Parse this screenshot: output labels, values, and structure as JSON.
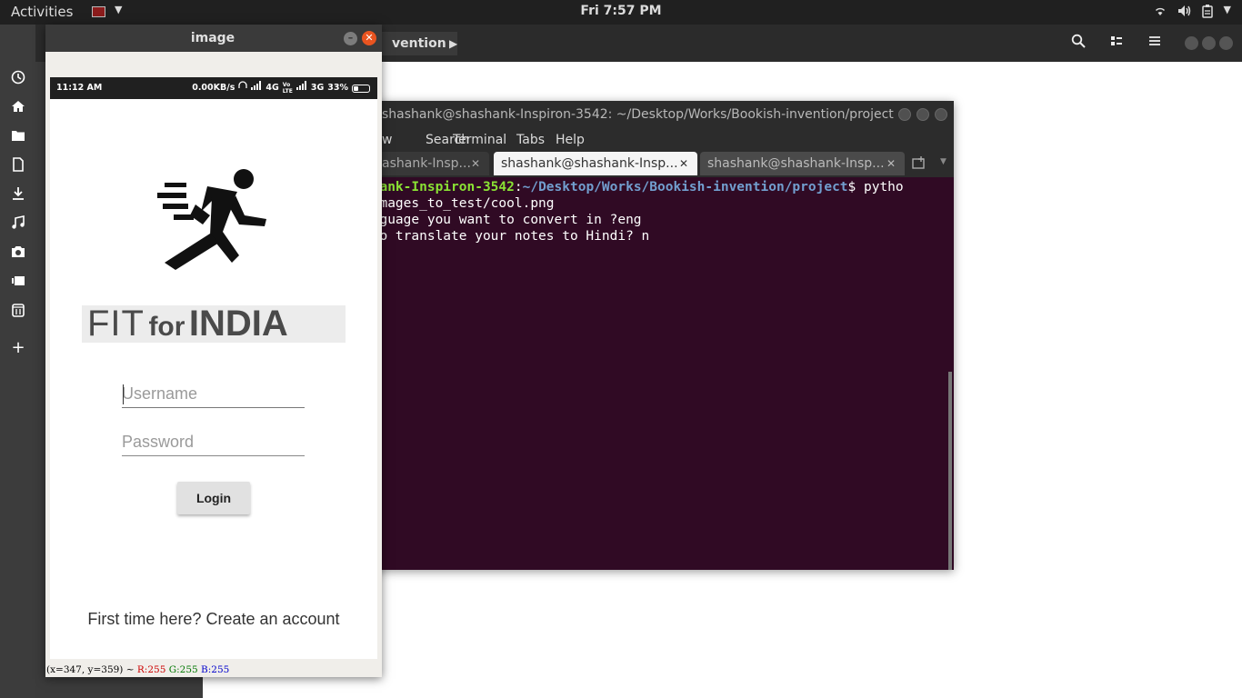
{
  "topbar": {
    "activities": "Activities",
    "clock": "Fri  7:57 PM",
    "tray_icons": [
      "wifi-icon",
      "volume-icon",
      "clipboard-icon",
      "menu-arrow-icon"
    ]
  },
  "dock": {
    "icons": [
      "recent-icon",
      "home-icon",
      "folder-icon",
      "document-icon",
      "download-icon",
      "music-icon",
      "camera-icon",
      "video-icon",
      "trash-icon",
      "add-location-icon"
    ]
  },
  "files": {
    "breadcrumb": "vention"
  },
  "terminal": {
    "title": "shashank@shashank-Inspiron-3542: ~/Desktop/Works/Bookish-invention/project",
    "menu": [
      "w",
      "Search",
      "Terminal",
      "Tabs",
      "Help"
    ],
    "tabs": [
      {
        "label": "ashank-Insp..."
      },
      {
        "label": "shashank@shashank-Insp..."
      },
      {
        "label": "shashank@shashank-Insp..."
      }
    ],
    "prompt_user": "shank-Inspiron-3542",
    "prompt_path": "~/Desktop/Works/Bookish-invention/project",
    "prompt_cmd": "$ pytho",
    "lines": [
      "/images_to_test/cool.png",
      "anguage you want to convert in ?eng",
      " to translate your notes to Hindi? n"
    ]
  },
  "viewer": {
    "title": "image",
    "status": {
      "coords": "(x=347, y=359) ~",
      "r": "R:255",
      "g": "G:255",
      "b": "B:255"
    }
  },
  "phone": {
    "time": "11:12 AM",
    "status_right": "0.00KB/s",
    "network_4g": "4G",
    "network_3g": "3G",
    "battery_percent": "33%",
    "battery_level": 0.33,
    "logo": {
      "fit": "FIT",
      "for": "for",
      "india": "INDIA"
    },
    "username_placeholder": "Username",
    "password_placeholder": "Password",
    "login_label": "Login",
    "signup_text": "First time here? Create an account"
  }
}
